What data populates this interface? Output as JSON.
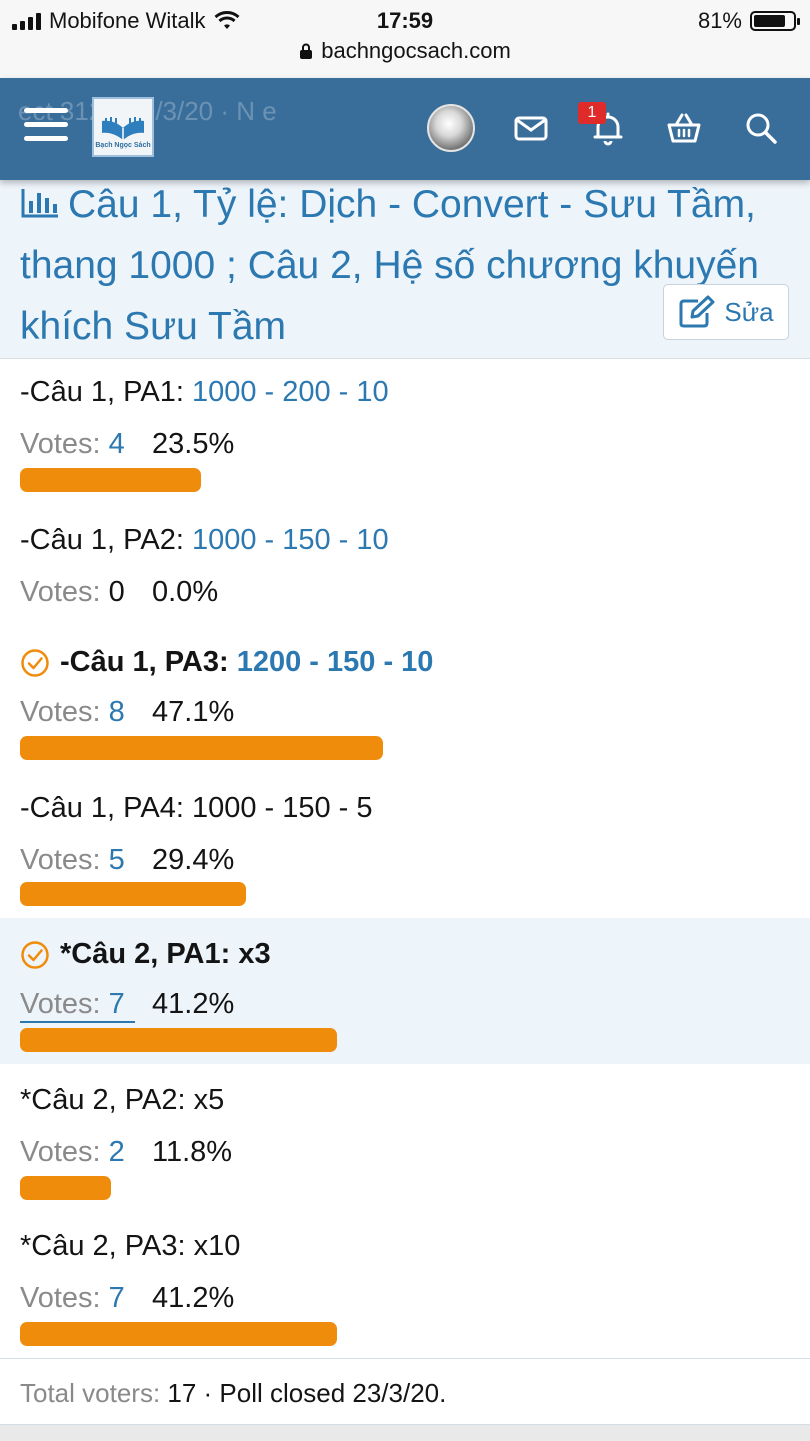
{
  "status_bar": {
    "carrier": "Mobifone Witalk",
    "time": "17:59",
    "battery": "81%",
    "battery_level": 0.81,
    "url": "bachngocsach.com"
  },
  "header": {
    "ghost_meta": "ect 312 · 19/3/20 · N e",
    "logo_text": "Bạch Ngọc Sách",
    "notification_count": "1",
    "icons": [
      "menu-icon",
      "avatar",
      "mail-icon",
      "bell-icon",
      "basket-icon",
      "search-icon"
    ]
  },
  "poll": {
    "title": "Câu 1, Tỷ lệ: Dịch - Convert - Sưu Tầm, thang 1000 ; Câu 2, Hệ số chương khuyến khích Sưu Tầm",
    "edit_label": "Sửa",
    "options": [
      {
        "prefix": "-Câu 1, PA1: ",
        "value": "1000 - 200 - 10",
        "votes_label": "Votes: ",
        "votes": "4",
        "percent": "23.5%",
        "fraction": 0.235,
        "chosen": false
      },
      {
        "prefix": "-Câu 1, PA2: ",
        "value": "1000 - 150 - 10",
        "votes_label": "Votes: ",
        "votes": "0",
        "percent": "0.0%",
        "fraction": 0.0,
        "chosen": false
      },
      {
        "prefix": "-Câu 1, PA3: ",
        "value": "1200 - 150 - 10",
        "votes_label": "Votes: ",
        "votes": "8",
        "percent": "47.1%",
        "fraction": 0.471,
        "chosen": true
      },
      {
        "prefix": "-Câu 1, PA4: ",
        "value": "1000 - 150 - 5",
        "votes_label": "Votes: ",
        "votes": "5",
        "percent": "29.4%",
        "fraction": 0.294,
        "chosen": false
      },
      {
        "prefix": "*Câu 2, PA1: ",
        "value": "x3",
        "votes_label": "Votes: ",
        "votes": "7",
        "percent": "41.2%",
        "fraction": 0.412,
        "chosen": true
      },
      {
        "prefix": "*Câu 2, PA2: ",
        "value": "x5",
        "votes_label": "Votes: ",
        "votes": "2",
        "percent": "11.8%",
        "fraction": 0.118,
        "chosen": false
      },
      {
        "prefix": "*Câu 2, PA3: ",
        "value": "x10",
        "votes_label": "Votes: ",
        "votes": "7",
        "percent": "41.2%",
        "fraction": 0.412,
        "chosen": false
      }
    ],
    "footer": {
      "total_label": "Total voters: ",
      "total": "17",
      "closed": " · Poll closed 23/3/20."
    }
  },
  "colors": {
    "header": "#3a6e9a",
    "link": "#2c78b0",
    "bar": "#f08c0c",
    "highlight": "#edf4fa",
    "badge": "#e02b2b"
  }
}
